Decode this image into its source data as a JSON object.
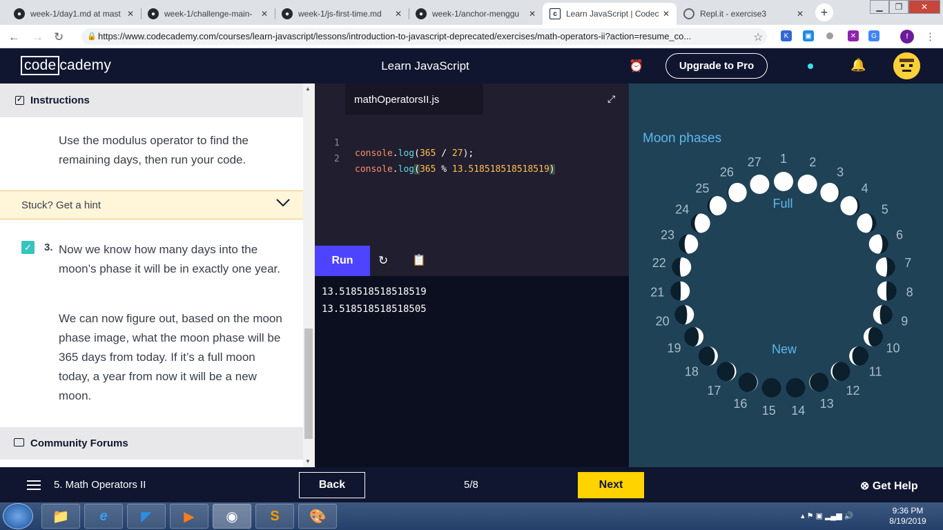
{
  "browser": {
    "tabs": [
      {
        "title": "week-1/day1.md at mast",
        "icon": "github-icon"
      },
      {
        "title": "week-1/challenge-main-",
        "icon": "github-icon"
      },
      {
        "title": "week-1/js-first-time.md",
        "icon": "github-icon"
      },
      {
        "title": "week-1/anchor-menggu",
        "icon": "github-icon"
      },
      {
        "title": "Learn JavaScript | Codec",
        "icon": "codecademy-icon"
      },
      {
        "title": "Repl.it - exercise3",
        "icon": "replit-icon"
      }
    ],
    "active_tab": 4,
    "url": "https://www.codecademy.com/courses/learn-javascript/lessons/introduction-to-javascript-deprecated/exercises/math-operators-ii?action=resume_co...",
    "new_tab": "+"
  },
  "header": {
    "logo_box": "code",
    "logo_rest": "cademy",
    "course_title": "Learn JavaScript",
    "upgrade_label": "Upgrade to Pro"
  },
  "instructions": {
    "title": "Instructions",
    "step_text": "Use the modulus operator to find the remaining days, then run your code.",
    "hint_label": "Stuck? Get a hint",
    "step3_number": "3.",
    "step3_p1": "Now we know how many days into the moon’s phase it will be in exactly one year.",
    "step3_p2": "We can now figure out, based on the moon phase image, what the moon phase will be 365 days from today. If it’s a full moon today, a year from now it will be a new moon.",
    "forums_label": "Community Forums"
  },
  "editor": {
    "filename": "mathOperatorsII.js",
    "lines": [
      {
        "num": "1",
        "obj": "console",
        "fn": "log",
        "a": "365",
        "op": "/",
        "b": "27",
        "end": ");"
      },
      {
        "num": "2",
        "obj": "console",
        "fn": "log",
        "a": "365",
        "op": "%",
        "b": "13.518518518518519",
        "end": ")"
      }
    ],
    "run_label": "Run"
  },
  "output": {
    "lines": [
      "13.518518518518519",
      "13.518518518518505"
    ]
  },
  "moon": {
    "title": "Moon phases",
    "full_label": "Full",
    "new_label": "New",
    "days": [
      "1",
      "2",
      "3",
      "4",
      "5",
      "6",
      "7",
      "8",
      "9",
      "10",
      "11",
      "12",
      "13",
      "14",
      "15",
      "16",
      "17",
      "18",
      "19",
      "20",
      "21",
      "22",
      "23",
      "24",
      "25",
      "26",
      "27"
    ],
    "colors": {
      "bg": "#1f4257",
      "light": "#ffffff",
      "dark": "#0b1f2c",
      "label": "#a9bdc8",
      "title": "#5fb7e8"
    }
  },
  "footer": {
    "lesson": "5. Math Operators II",
    "back_label": "Back",
    "progress": "5/8",
    "next_label": "Next",
    "help_label": "Get Help"
  },
  "taskbar": {
    "time": "9:36 PM",
    "date": "8/19/2019"
  }
}
